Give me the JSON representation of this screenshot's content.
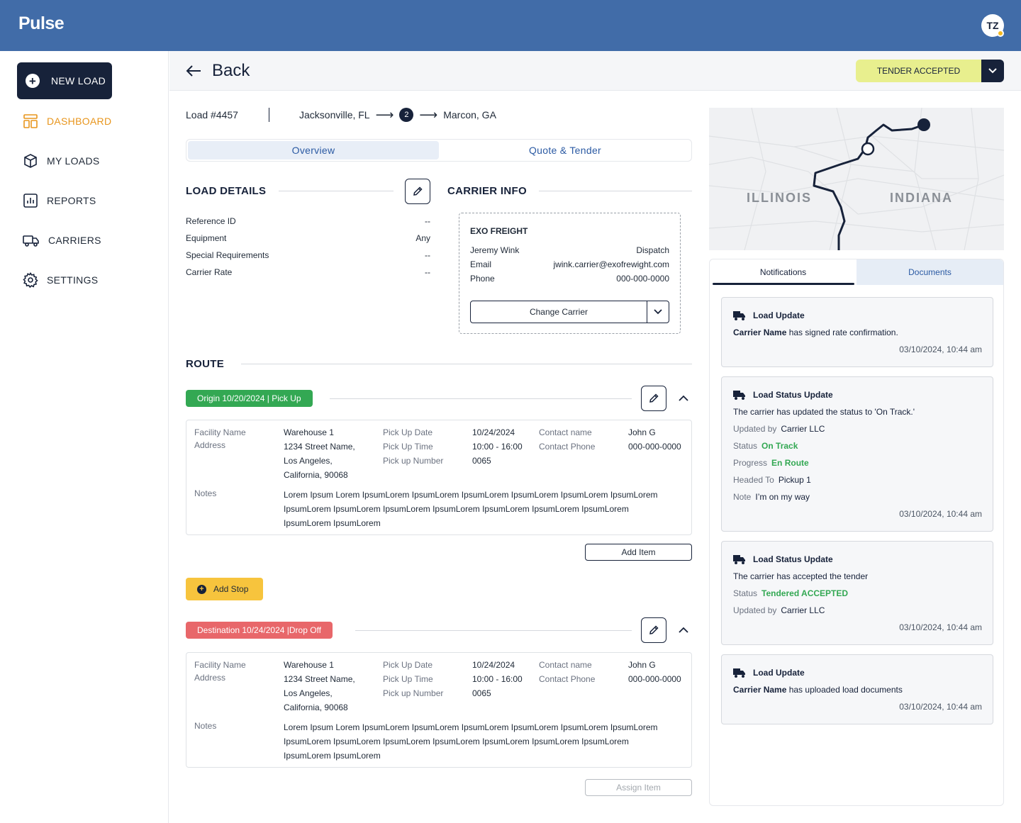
{
  "app": {
    "logo": "Pulse",
    "user_initials": "TZ"
  },
  "sidebar": {
    "new_load": "NEW LOAD",
    "items": [
      {
        "label": "DASHBOARD",
        "active": true
      },
      {
        "label": "MY LOADS"
      },
      {
        "label": "REPORTS"
      },
      {
        "label": "CARRIERS"
      },
      {
        "label": "SETTINGS"
      }
    ]
  },
  "header": {
    "back": "Back",
    "status": "TENDER ACCEPTED"
  },
  "load": {
    "id": "Load #4457",
    "origin": "Jacksonville, FL",
    "stops": "2",
    "destination": "Marcon, GA"
  },
  "tabs": [
    "Overview",
    "Quote & Tender"
  ],
  "load_details": {
    "title": "LOAD DETAILS",
    "rows": [
      {
        "label": "Reference ID",
        "value": "--"
      },
      {
        "label": "Equipment",
        "value": "Any"
      },
      {
        "label": "Special Requirements",
        "value": "--"
      },
      {
        "label": "Carrier Rate",
        "value": "--"
      }
    ]
  },
  "carrier_info": {
    "title": "CARRIER INFO",
    "name": "EXO FREIGHT",
    "contact": "Jeremy Wink",
    "role": "Dispatch",
    "email_label": "Email",
    "email": "jwink.carrier@exofrewight.com",
    "phone_label": "Phone",
    "phone": "000-000-0000",
    "change": "Change Carrier"
  },
  "route": {
    "title": "ROUTE",
    "add_stop": "Add Stop",
    "labels": {
      "facility": "Facility Name",
      "address": "Address",
      "notes": "Notes",
      "pickup_date": "Pick Up Date",
      "pickup_time": "Pick Up Time",
      "pickup_number": "Pick up Number",
      "contact_name": "Contact name",
      "contact_phone": "Contact Phone"
    },
    "stops": [
      {
        "tag": "Origin 10/20/2024 | Pick Up",
        "facility": "Warehouse 1",
        "address1": "1234 Street Name,",
        "address2": "Los Angeles,",
        "address3": "California, 90068",
        "date": "10/24/2024",
        "time": "10:00 - 16:00",
        "number": "0065",
        "contact": "John G",
        "phone": "000-000-0000",
        "notes1": "Lorem Ipsum Lorem IpsumLorem IpsumLorem IpsumLorem IpsumLorem IpsumLorem IpsumLorem",
        "notes2": "IpsumLorem IpsumLorem IpsumLorem IpsumLorem IpsumLorem IpsumLorem IpsumLorem",
        "notes3": "IpsumLorem IpsumLorem",
        "button": "Add Item"
      },
      {
        "tag": "Destination 10/24/2024 |Drop Off",
        "facility": "Warehouse 1",
        "address1": "1234 Street Name,",
        "address2": "Los Angeles,",
        "address3": "California, 90068",
        "date": "10/24/2024",
        "time": "10:00 - 16:00",
        "number": "0065",
        "contact": "John G",
        "phone": "000-000-0000",
        "notes1": "Lorem Ipsum Lorem IpsumLorem IpsumLorem IpsumLorem IpsumLorem IpsumLorem IpsumLorem",
        "notes2": "IpsumLorem IpsumLorem IpsumLorem IpsumLorem IpsumLorem IpsumLorem IpsumLorem",
        "notes3": "IpsumLorem IpsumLorem",
        "button": "Assign Item"
      }
    ]
  },
  "map": {
    "labels": [
      "ILLINOIS",
      "INDIANA"
    ]
  },
  "panel": {
    "tabs": [
      "Notifications",
      "Documents"
    ],
    "notifications": [
      {
        "title": "Load Update",
        "body_bold": "Carrier Name",
        "body": " has signed rate confirmation.",
        "time": "03/10/2024, 10:44 am"
      },
      {
        "title": "Load Status Update",
        "body": "The carrier has updated  the status to 'On Track.'",
        "updated_label": "Updated by",
        "updated": "Carrier LLC",
        "status_label": "Status",
        "status": "On Track",
        "progress_label": "Progress",
        "progress": "En Route",
        "headed_label": "Headed To",
        "headed": "Pickup 1",
        "note_label": "Note",
        "note": "I’m on my way",
        "time": "03/10/2024, 10:44 am"
      },
      {
        "title": "Load Status Update",
        "body": "The carrier has accepted the tender",
        "status_label": "Status",
        "status": "Tendered ACCEPTED",
        "updated_label": "Updated by",
        "updated": "Carrier LLC",
        "time": "03/10/2024, 10:44 am"
      },
      {
        "title": "Load Update",
        "body_bold": "Carrier Name",
        "body": " has uploaded load documents",
        "time": "03/10/2024, 10:44 am"
      }
    ]
  },
  "colors": {
    "primary": "#17223a",
    "header": "#416ca8",
    "active": "#e8951c",
    "success": "#33a853",
    "danger": "#e8676a",
    "warning": "#f7c43d",
    "status_pill": "#e8ef8e"
  }
}
